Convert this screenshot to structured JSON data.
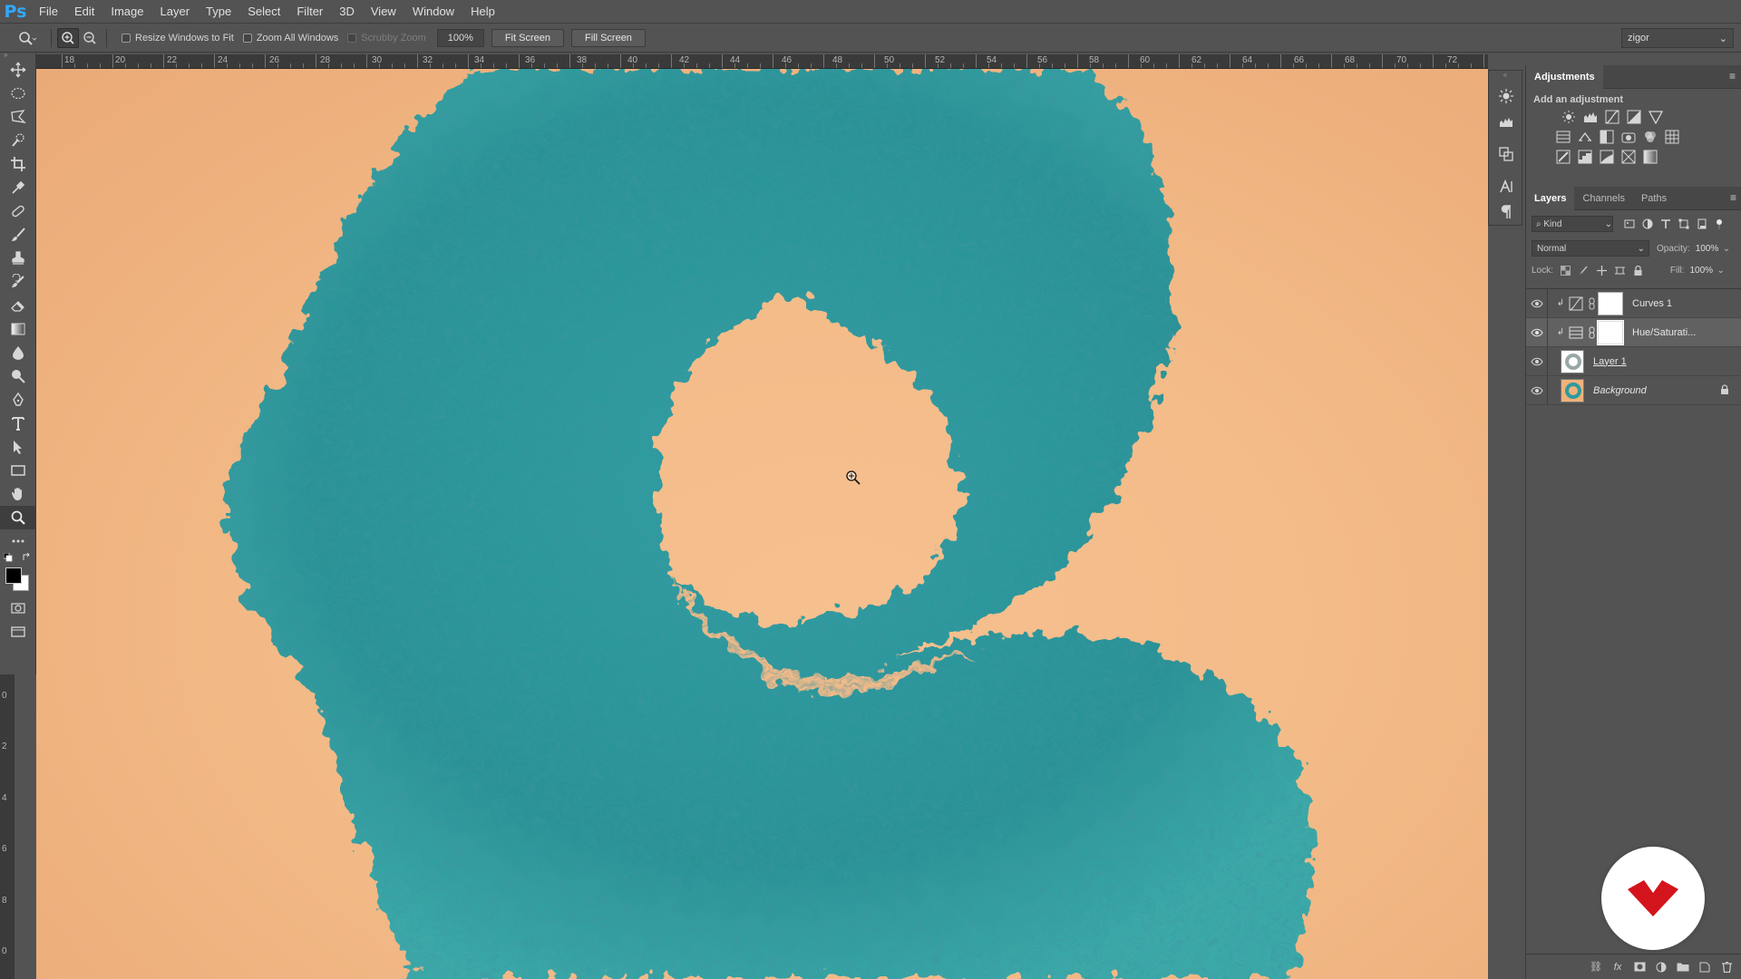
{
  "app": {
    "logo": "Ps"
  },
  "menu": [
    "File",
    "Edit",
    "Image",
    "Layer",
    "Type",
    "Select",
    "Filter",
    "3D",
    "View",
    "Window",
    "Help"
  ],
  "options": {
    "resize_windows_label": "Resize Windows to Fit",
    "zoom_all_label": "Zoom All Windows",
    "scrubby_label": "Scrubby Zoom",
    "zoom_value": "100%",
    "fit_screen_label": "Fit Screen",
    "fill_screen_label": "Fill Screen",
    "workspace": "zigor"
  },
  "ruler": {
    "top_numbers": [
      "18",
      "20",
      "22",
      "24",
      "26",
      "28",
      "30",
      "32",
      "34",
      "36",
      "38",
      "40",
      "42",
      "44",
      "46",
      "48",
      "50",
      "52",
      "54",
      "56",
      "58",
      "60",
      "62",
      "64",
      "66",
      "68",
      "70",
      "72"
    ],
    "left_numbers": [
      "0",
      "2",
      "4",
      "6",
      "8",
      "0"
    ]
  },
  "adjustments": {
    "tab_label": "Adjustments",
    "add_label": "Add an adjustment"
  },
  "layers_panel": {
    "tabs": [
      "Layers",
      "Channels",
      "Paths"
    ],
    "kind_label": "Kind",
    "blend_mode": "Normal",
    "opacity_label": "Opacity:",
    "opacity_value": "100%",
    "lock_label": "Lock:",
    "fill_label": "Fill:",
    "fill_value": "100%",
    "layers": [
      {
        "name": "Curves 1",
        "type": "adjustment-curves"
      },
      {
        "name": "Hue/Saturati...",
        "type": "adjustment-hue",
        "selected": true
      },
      {
        "name": "Layer 1",
        "type": "pixel"
      },
      {
        "name": "Background",
        "type": "background",
        "locked": true
      }
    ]
  },
  "colors": {
    "ui_bg": "#535353",
    "canvas_bg": "#f3bb88",
    "fur": "#2e9a9e",
    "ps_blue": "#31a8ff",
    "brand_red": "#d4141c"
  }
}
